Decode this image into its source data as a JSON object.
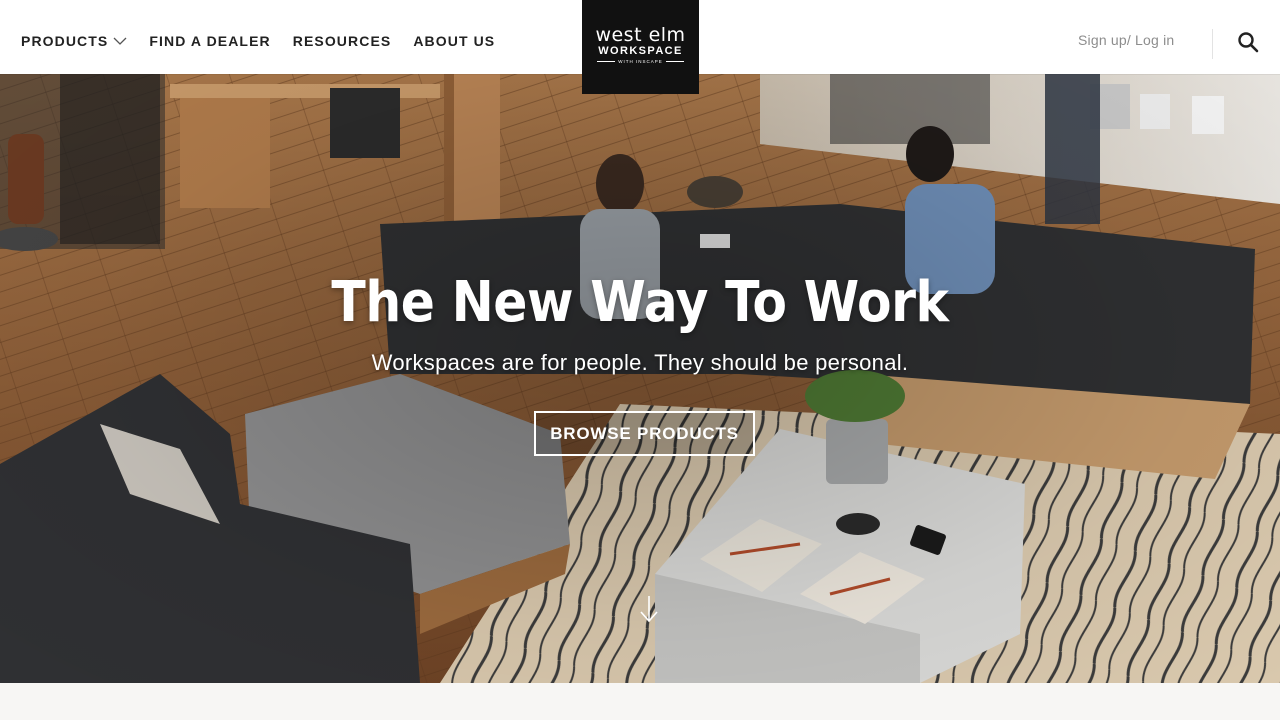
{
  "nav": {
    "items": [
      {
        "label": "PRODUCTS",
        "has_dropdown": true
      },
      {
        "label": "FIND A DEALER"
      },
      {
        "label": "RESOURCES"
      },
      {
        "label": "ABOUT US"
      }
    ]
  },
  "logo": {
    "main": "west elm",
    "sub": "WORKSPACE",
    "tiny": "WITH INSCAPE"
  },
  "header_right": {
    "auth_label": "Sign up/ Log in",
    "search_icon": "search-icon"
  },
  "hero": {
    "title": "The New Way To Work",
    "subtitle": "Workspaces are for people. They should be personal.",
    "cta_label": "BROWSE PRODUCTS",
    "scroll_icon": "arrow-down-icon"
  },
  "colors": {
    "header_bg": "#ffffff",
    "logo_bg": "#111111",
    "nav_text": "#222222",
    "auth_text": "#8d8d8d",
    "hero_text": "#ffffff"
  }
}
